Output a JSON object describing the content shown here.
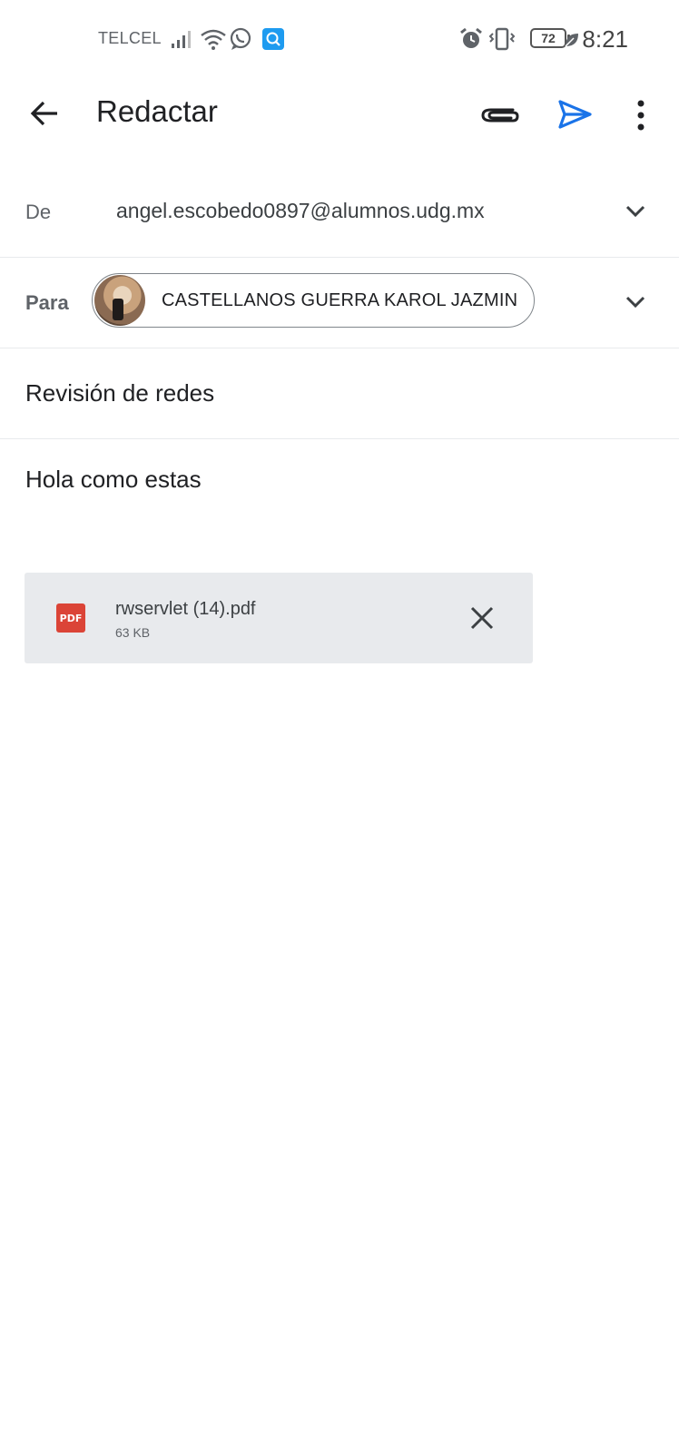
{
  "status_bar": {
    "carrier": "TELCEL",
    "battery": "72",
    "time": "8:21",
    "icons": [
      "signal-icon",
      "wifi-icon",
      "whatsapp-icon",
      "search-app-icon",
      "alarm-icon",
      "vibrate-icon",
      "battery-icon",
      "leaf-icon"
    ]
  },
  "app_bar": {
    "title": "Redactar",
    "icons": [
      "back-arrow-icon",
      "attach-icon",
      "send-icon",
      "more-vert-icon"
    ],
    "send_color": "#1a73e8"
  },
  "from": {
    "label": "De",
    "value": "angel.escobedo0897@alumnos.udg.mx"
  },
  "to": {
    "label": "Para",
    "recipient": "CASTELLANOS GUERRA KAROL JAZMIN"
  },
  "subject": "Revisión de redes",
  "body": "Hola como estas",
  "attachment": {
    "badge": "PDF",
    "name": "rwservlet (14).pdf",
    "size": "63 KB"
  }
}
